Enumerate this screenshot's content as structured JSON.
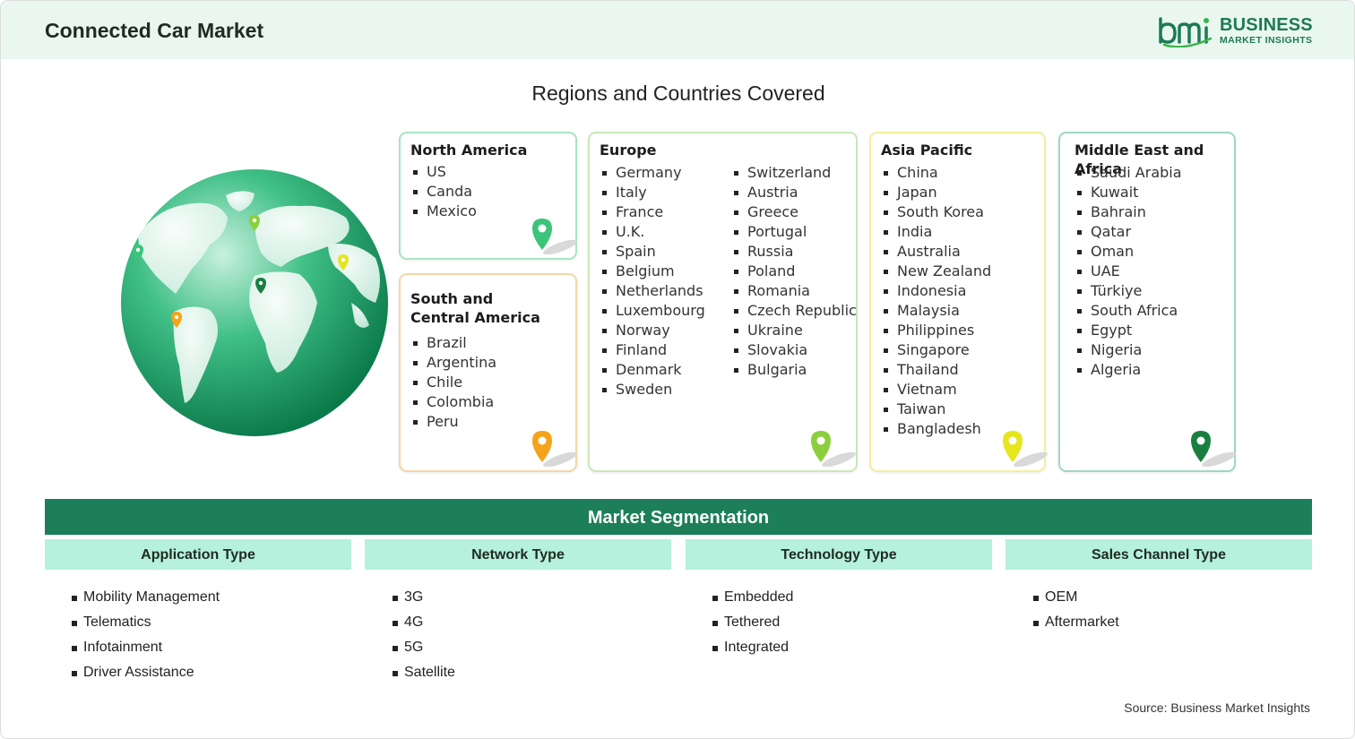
{
  "header": {
    "title": "Connected Car Market",
    "logo_word1": "BUSINESS",
    "logo_word2": "MARKET INSIGHTS"
  },
  "regions_title": "Regions and Countries Covered",
  "regions": {
    "north_america": {
      "name": "North America",
      "countries": [
        "US",
        "Canda",
        "Mexico"
      ],
      "pin_color": "#3cc47a"
    },
    "south_central_america": {
      "name_line1": "South and",
      "name_line2": "Central America",
      "countries": [
        "Brazil",
        "Argentina",
        "Chile",
        "Colombia",
        "Peru"
      ],
      "pin_color": "#f5a31a"
    },
    "europe": {
      "name": "Europe",
      "countries_col1": [
        "Germany",
        "Italy",
        "France",
        "U.K.",
        "Spain",
        "Belgium",
        "Netherlands",
        "Luxembourg",
        "Norway",
        "Finland",
        "Denmark",
        "Sweden"
      ],
      "countries_col2": [
        "Switzerland",
        "Austria",
        "Greece",
        "Portugal",
        "Russia",
        "Poland",
        "Romania",
        "Czech Republic",
        "Ukraine",
        "Slovakia",
        "Bulgaria"
      ],
      "pin_color": "#8ccf3c"
    },
    "asia_pacific": {
      "name": "Asia Pacific",
      "countries": [
        "China",
        "Japan",
        "South Korea",
        "India",
        "Australia",
        "New Zealand",
        "Indonesia",
        "Malaysia",
        "Philippines",
        "Singapore",
        "Thailand",
        "Vietnam",
        "Taiwan",
        "Bangladesh"
      ],
      "pin_color": "#e6e61e"
    },
    "middle_east_africa": {
      "name": "Middle East and Africa",
      "countries": [
        "Saudi Arabia",
        "Kuwait",
        "Bahrain",
        "Qatar",
        "Oman",
        "UAE",
        "Türkiye",
        "South Africa",
        "Egypt",
        "Nigeria",
        "Algeria"
      ],
      "pin_color": "#1a7f3e"
    }
  },
  "segmentation": {
    "title": "Market Segmentation",
    "columns": [
      {
        "header": "Application Type",
        "items": [
          "Mobility Management",
          "Telematics",
          "Infotainment",
          "Driver Assistance"
        ]
      },
      {
        "header": "Network Type",
        "items": [
          "3G",
          "4G",
          "5G",
          "Satellite"
        ]
      },
      {
        "header": "Technology Type",
        "items": [
          "Embedded",
          "Tethered",
          "Integrated"
        ]
      },
      {
        "header": "Sales Channel Type",
        "items": [
          "OEM",
          "Aftermarket"
        ]
      }
    ]
  },
  "source": "Source: Business Market Insights",
  "colors": {
    "brand_green": "#1d7f5a",
    "header_bg": "#eaf7f0",
    "segment_header_bg": "#b5f1dc"
  }
}
